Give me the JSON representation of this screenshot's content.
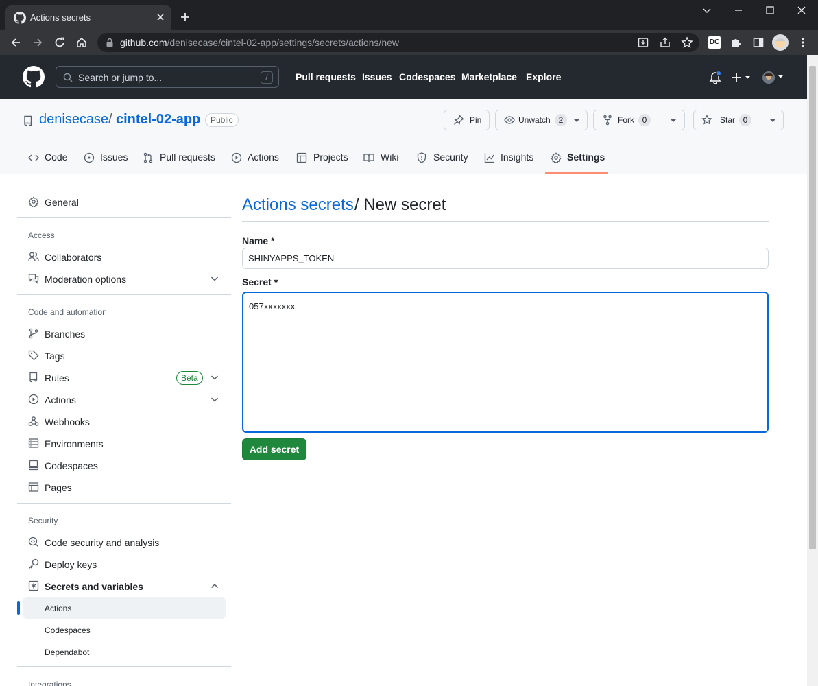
{
  "browser": {
    "tab_title": "Actions secrets",
    "url_host": "github.com",
    "url_path": "/denisecase/cintel-02-app/settings/secrets/actions/new",
    "ext_badge": "DC"
  },
  "github": {
    "search_placeholder": "Search or jump to...",
    "search_shortcut": "/",
    "nav": [
      "Pull requests",
      "Issues",
      "Codespaces",
      "Marketplace",
      "Explore"
    ]
  },
  "repo": {
    "owner": "denisecase",
    "separator": "/",
    "name": "cintel-02-app",
    "visibility": "Public",
    "pin_label": "Pin",
    "unwatch_label": "Unwatch",
    "unwatch_count": "2",
    "fork_label": "Fork",
    "fork_count": "0",
    "star_label": "Star",
    "star_count": "0",
    "tabs": [
      "Code",
      "Issues",
      "Pull requests",
      "Actions",
      "Projects",
      "Wiki",
      "Security",
      "Insights",
      "Settings"
    ],
    "active_tab": "Settings"
  },
  "sidebar": {
    "general": "General",
    "access_heading": "Access",
    "collaborators": "Collaborators",
    "moderation": "Moderation options",
    "code_heading": "Code and automation",
    "branches": "Branches",
    "tags": "Tags",
    "rules": "Rules",
    "rules_badge": "Beta",
    "actions": "Actions",
    "webhooks": "Webhooks",
    "environments": "Environments",
    "codespaces": "Codespaces",
    "pages": "Pages",
    "security_heading": "Security",
    "code_security": "Code security and analysis",
    "deploy_keys": "Deploy keys",
    "secrets": "Secrets and variables",
    "sub_actions": "Actions",
    "sub_codespaces": "Codespaces",
    "sub_dependabot": "Dependabot",
    "integrations_heading": "Integrations"
  },
  "main": {
    "breadcrumb_link": "Actions secrets",
    "breadcrumb_current": "/ New secret",
    "name_label": "Name *",
    "name_value": "SHINYAPPS_TOKEN",
    "secret_label": "Secret *",
    "secret_value": "057xxxxxxx",
    "submit_label": "Add secret"
  },
  "colors": {
    "accent": "#0969da",
    "primary_button": "#1f883d",
    "tab_underline": "#fd8c73",
    "header_bg": "#24292f"
  }
}
